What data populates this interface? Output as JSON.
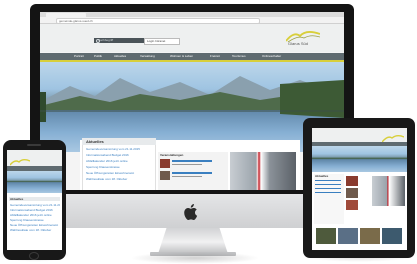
{
  "site": {
    "url": "gemeinde-glarus-sued.ch",
    "search_placeholder": "Suchbegriff",
    "login_label": "Login Intranet",
    "logo_text": "Glarus Süd",
    "nav": [
      "Portrait",
      "Politik",
      "Aktuelles",
      "Verwaltung",
      "Wohnen & Leben",
      "Freizeit",
      "Tourismus",
      "Onlineschalter"
    ],
    "news_heading": "Aktuelles",
    "news_items": [
      "Gemeindeversammlung vom 21.11.2015",
      "Informationsabend Budget 2016",
      "Abfallkalender 2016 jetzt online",
      "Sperrung Klausenstrasse",
      "Neue Öffnungszeiten Einwohneramt",
      "Wahlresultate vom 18. Oktober"
    ],
    "events_heading": "Veranstaltungen"
  },
  "colors": {
    "accent_yellow": "#d8cf3a",
    "nav_bar": "#5f6b70",
    "frame_black": "#1b1b1b",
    "aluminium": "#d9dadc",
    "news_link": "#3a7fc0"
  },
  "icons": {
    "apple_logo": "apple-logo-icon",
    "search": "search-icon"
  }
}
